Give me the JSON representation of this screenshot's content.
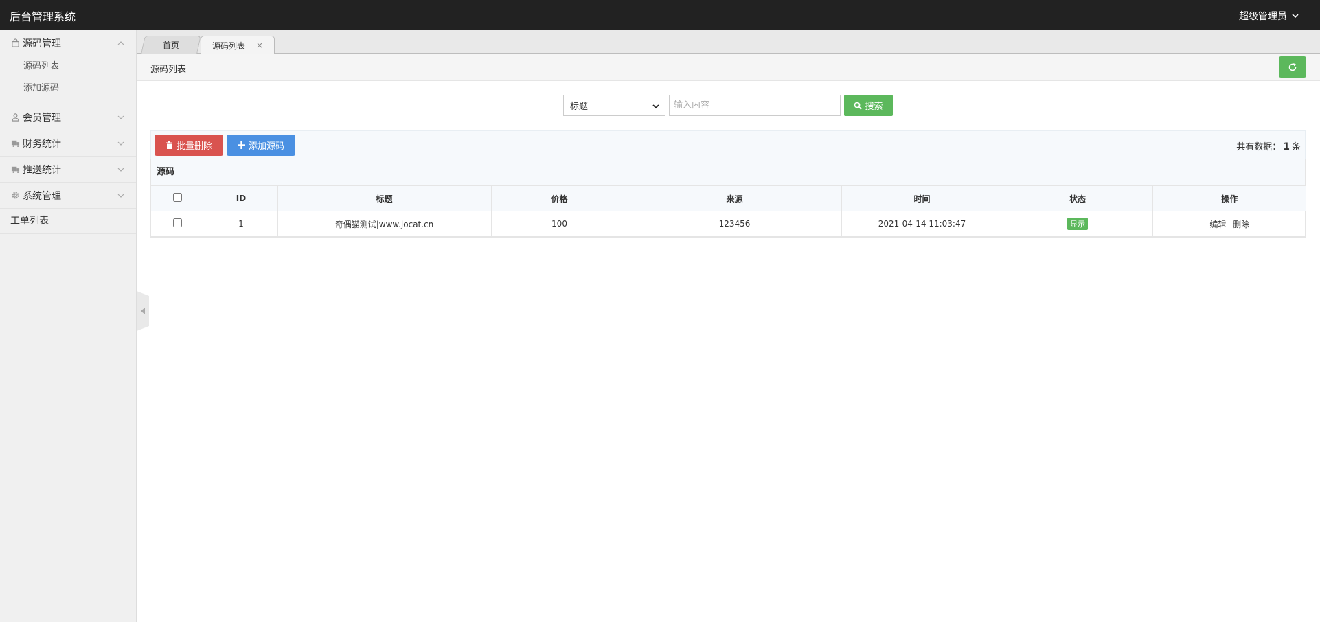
{
  "header": {
    "brand": "后台管理系统",
    "user": "超级管理员"
  },
  "sidebar": {
    "groups": [
      {
        "label": "源码管理",
        "icon": "bag-icon",
        "items": [
          "源码列表",
          "添加源码"
        ]
      },
      {
        "label": "会员管理",
        "icon": "user-icon"
      },
      {
        "label": "财务统计",
        "icon": "truck-icon"
      },
      {
        "label": "推送统计",
        "icon": "truck-icon"
      },
      {
        "label": "系统管理",
        "icon": "gear-icon"
      }
    ],
    "plain": "工单列表"
  },
  "tabs": {
    "home": "首页",
    "active": "源码列表",
    "close": "×"
  },
  "breadcrumb": "源码列表",
  "search": {
    "select": "标题",
    "placeholder": "输入内容",
    "button": "搜索"
  },
  "toolbar": {
    "batch_delete": "批量删除",
    "add": "添加源码",
    "total_prefix": "共有数据：",
    "total_count": "1",
    "total_suffix": "条"
  },
  "table": {
    "caption": "源码",
    "columns": [
      "ID",
      "标题",
      "价格",
      "来源",
      "时间",
      "状态",
      "操作"
    ],
    "rows": [
      {
        "id": "1",
        "title": "奇偶猫测试|www.jocat.cn",
        "price": "100",
        "source": "123456",
        "time": "2021-04-14 11:03:47",
        "status": "显示",
        "edit": "编辑",
        "delete": "删除"
      }
    ]
  },
  "colors": {
    "topbar": "#222222",
    "success": "#5cb85c",
    "danger": "#d9534f",
    "primary": "#4a90e2"
  }
}
